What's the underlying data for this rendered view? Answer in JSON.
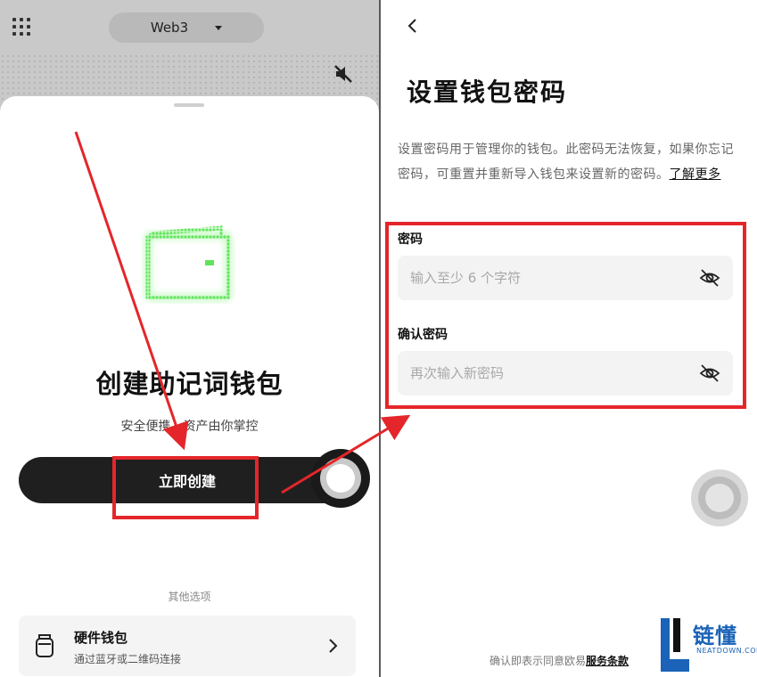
{
  "left_panel": {
    "network_selector": {
      "label": "Web3"
    },
    "sheet": {
      "title": "创建助记词钱包",
      "subtitle": "安全便携，资产由你掌控",
      "create_button": "立即创建",
      "other_options": "其他选项",
      "hardware_wallet": {
        "title": "硬件钱包",
        "subtitle": "通过蓝牙或二维码连接"
      }
    }
  },
  "right_panel": {
    "title": "设置钱包密码",
    "description": "设置密码用于管理你的钱包。此密码无法恢复，如果你忘记密码，可重置并重新导入钱包来设置新的密码。",
    "learn_more": "了解更多",
    "password": {
      "label": "密码",
      "placeholder": "输入至少 6 个字符",
      "value": ""
    },
    "confirm_password": {
      "label": "确认密码",
      "placeholder": "再次输入新密码",
      "value": ""
    },
    "terms_prefix": "确认即表示同意欧易",
    "terms_link": "服务条款"
  },
  "watermark": {
    "brand": "链懂",
    "domain": "NEATDOWN.COM"
  },
  "colors": {
    "accent_red": "#e4262a",
    "button_dark": "#1f1f1f",
    "wallet_green": "#5fe35a",
    "watermark_blue": "#1a63b8"
  },
  "icons": [
    "grid-menu-icon",
    "dropdown-triangle-icon",
    "mute-speaker-icon",
    "wallet-icon",
    "hardware-wallet-icon",
    "chevron-right-icon",
    "back-arrow-icon",
    "eye-off-icon"
  ]
}
